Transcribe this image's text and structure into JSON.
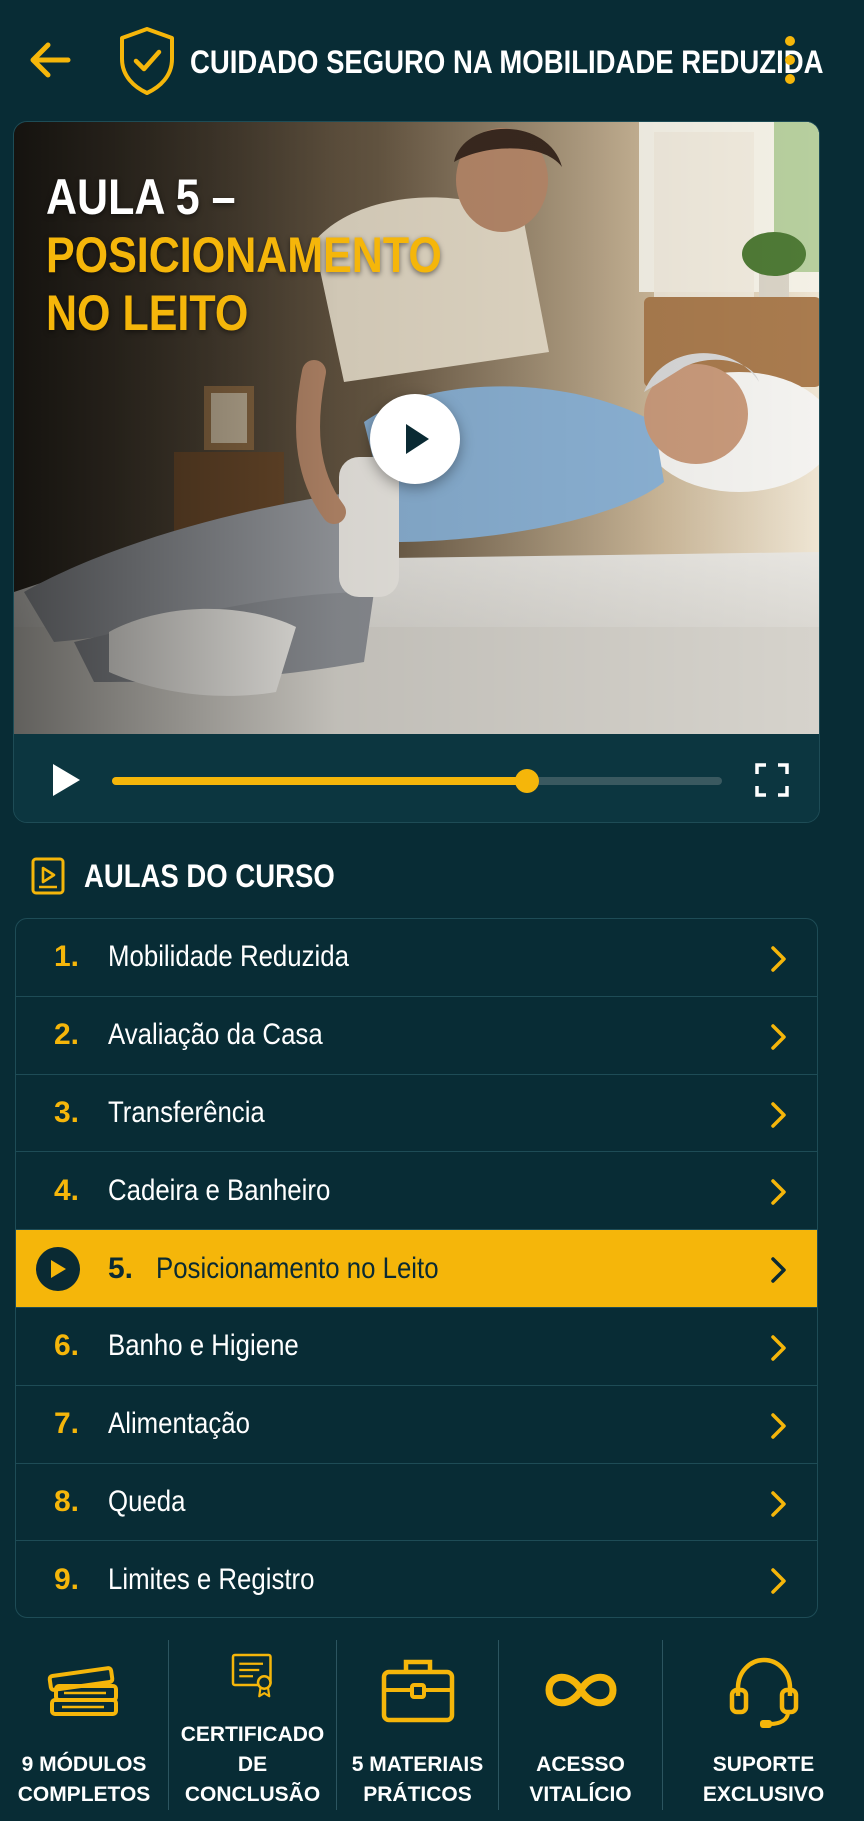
{
  "header": {
    "title": "CUIDADO SEGURO NA MOBILIDADE REDUZIDA",
    "back_icon": "arrow-left-icon",
    "shield_icon": "shield-check-icon",
    "menu_icon": "more-vertical-icon"
  },
  "video": {
    "title_line1": "AULA 5 –",
    "title_line2": "POSICIONAMENTO",
    "title_line3": "NO LEITO",
    "progress": 0.68
  },
  "lessons": {
    "heading": "AULAS DO CURSO",
    "items": [
      {
        "num": "1.",
        "label": "Mobilidade Reduzida"
      },
      {
        "num": "2.",
        "label": "Avaliação da Casa"
      },
      {
        "num": "3.",
        "label": "Transferência"
      },
      {
        "num": "4.",
        "label": "Cadeira e Banheiro"
      },
      {
        "num": "5.",
        "label": "Posicionamento no Leito",
        "active": true
      },
      {
        "num": "6.",
        "label": "Banho e Higiene"
      },
      {
        "num": "7.",
        "label": "Alimentação"
      },
      {
        "num": "8.",
        "label": "Queda"
      },
      {
        "num": "9.",
        "label": "Limites e Registro"
      }
    ]
  },
  "features": [
    {
      "icon": "books-icon",
      "line1": "9 MÓDULOS",
      "line2": "COMPLETOS"
    },
    {
      "icon": "certificate-icon",
      "line1": "CERTIFICADO",
      "line2": "DE CONCLUSÃO"
    },
    {
      "icon": "briefcase-icon",
      "line1": "5 MATERIAIS",
      "line2": "PRÁTICOS"
    },
    {
      "icon": "infinity-icon",
      "line1": "ACESSO",
      "line2": "VITALÍCIO"
    },
    {
      "icon": "headset-icon",
      "line1": "SUPORTE",
      "line2": "EXCLUSIVO"
    }
  ],
  "colors": {
    "background": "#082c35",
    "accent": "#f5b60a",
    "text": "#ffffff"
  }
}
